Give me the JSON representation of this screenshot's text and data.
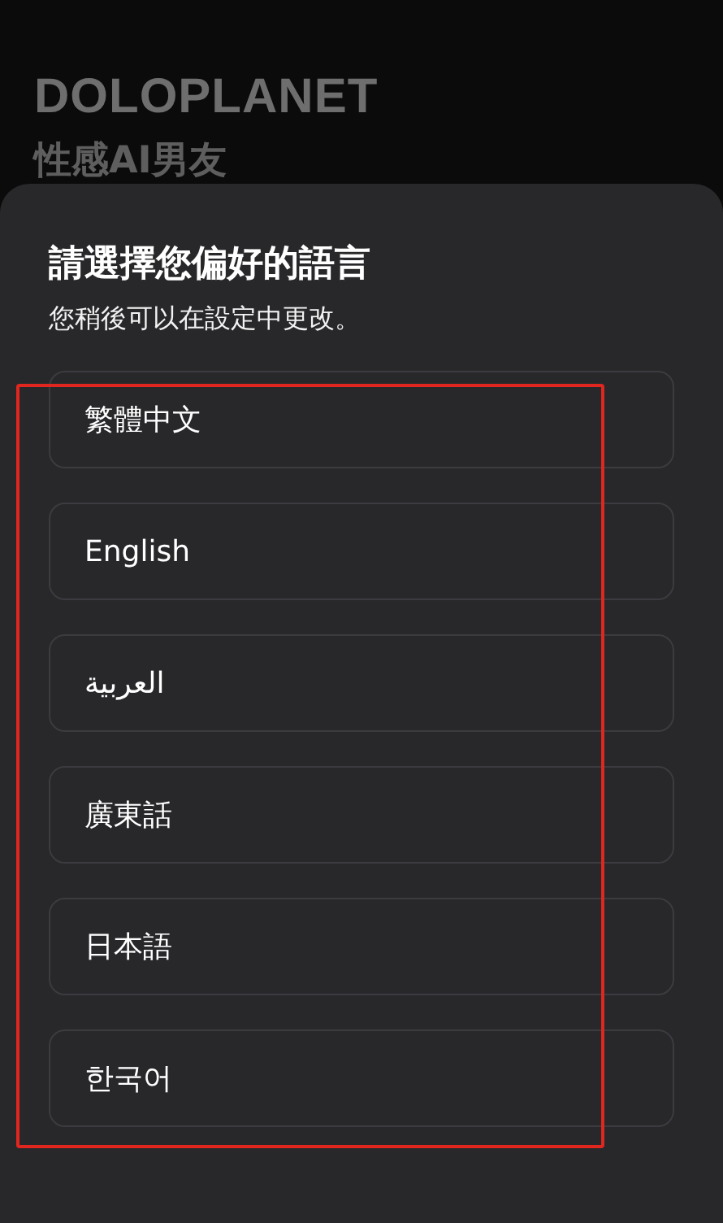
{
  "app": {
    "brand": "DOLOPLANET",
    "tagline": "性感AI男友"
  },
  "sheet": {
    "title": "請選擇您偏好的語言",
    "subtitle": "您稍後可以在設定中更改。",
    "options": [
      {
        "label": "繁體中文"
      },
      {
        "label": "English"
      },
      {
        "label": "العربية"
      },
      {
        "label": "廣東話"
      },
      {
        "label": "日本語"
      },
      {
        "label": "한국어"
      }
    ],
    "highlight": {
      "color": "#e0261f"
    }
  }
}
